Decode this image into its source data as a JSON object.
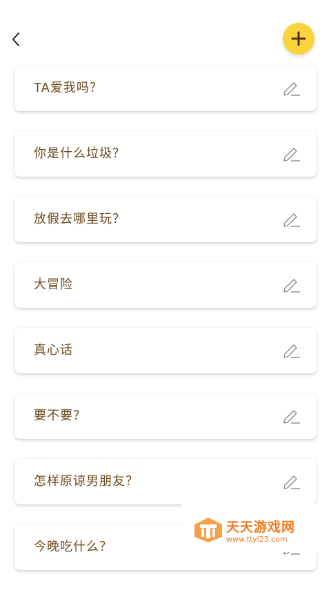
{
  "header": {
    "back_icon": "chevron-left-icon",
    "add_icon": "plus-icon",
    "accent_color": "#fbd33b"
  },
  "topics": [
    {
      "title": "TA爱我吗？"
    },
    {
      "title": "你是什么垃圾？"
    },
    {
      "title": "放假去哪里玩？"
    },
    {
      "title": "大冒险"
    },
    {
      "title": "真心话"
    },
    {
      "title": "要不要？"
    },
    {
      "title": "怎样原谅男朋友？"
    },
    {
      "title": "今晚吃什么？"
    }
  ],
  "edit_icon": "pencil-icon",
  "watermark": {
    "title": "天天游戏网",
    "url": "www.ttyl23.com"
  },
  "colors": {
    "text": "#6d4a1f",
    "watermark": "#f47a20"
  }
}
